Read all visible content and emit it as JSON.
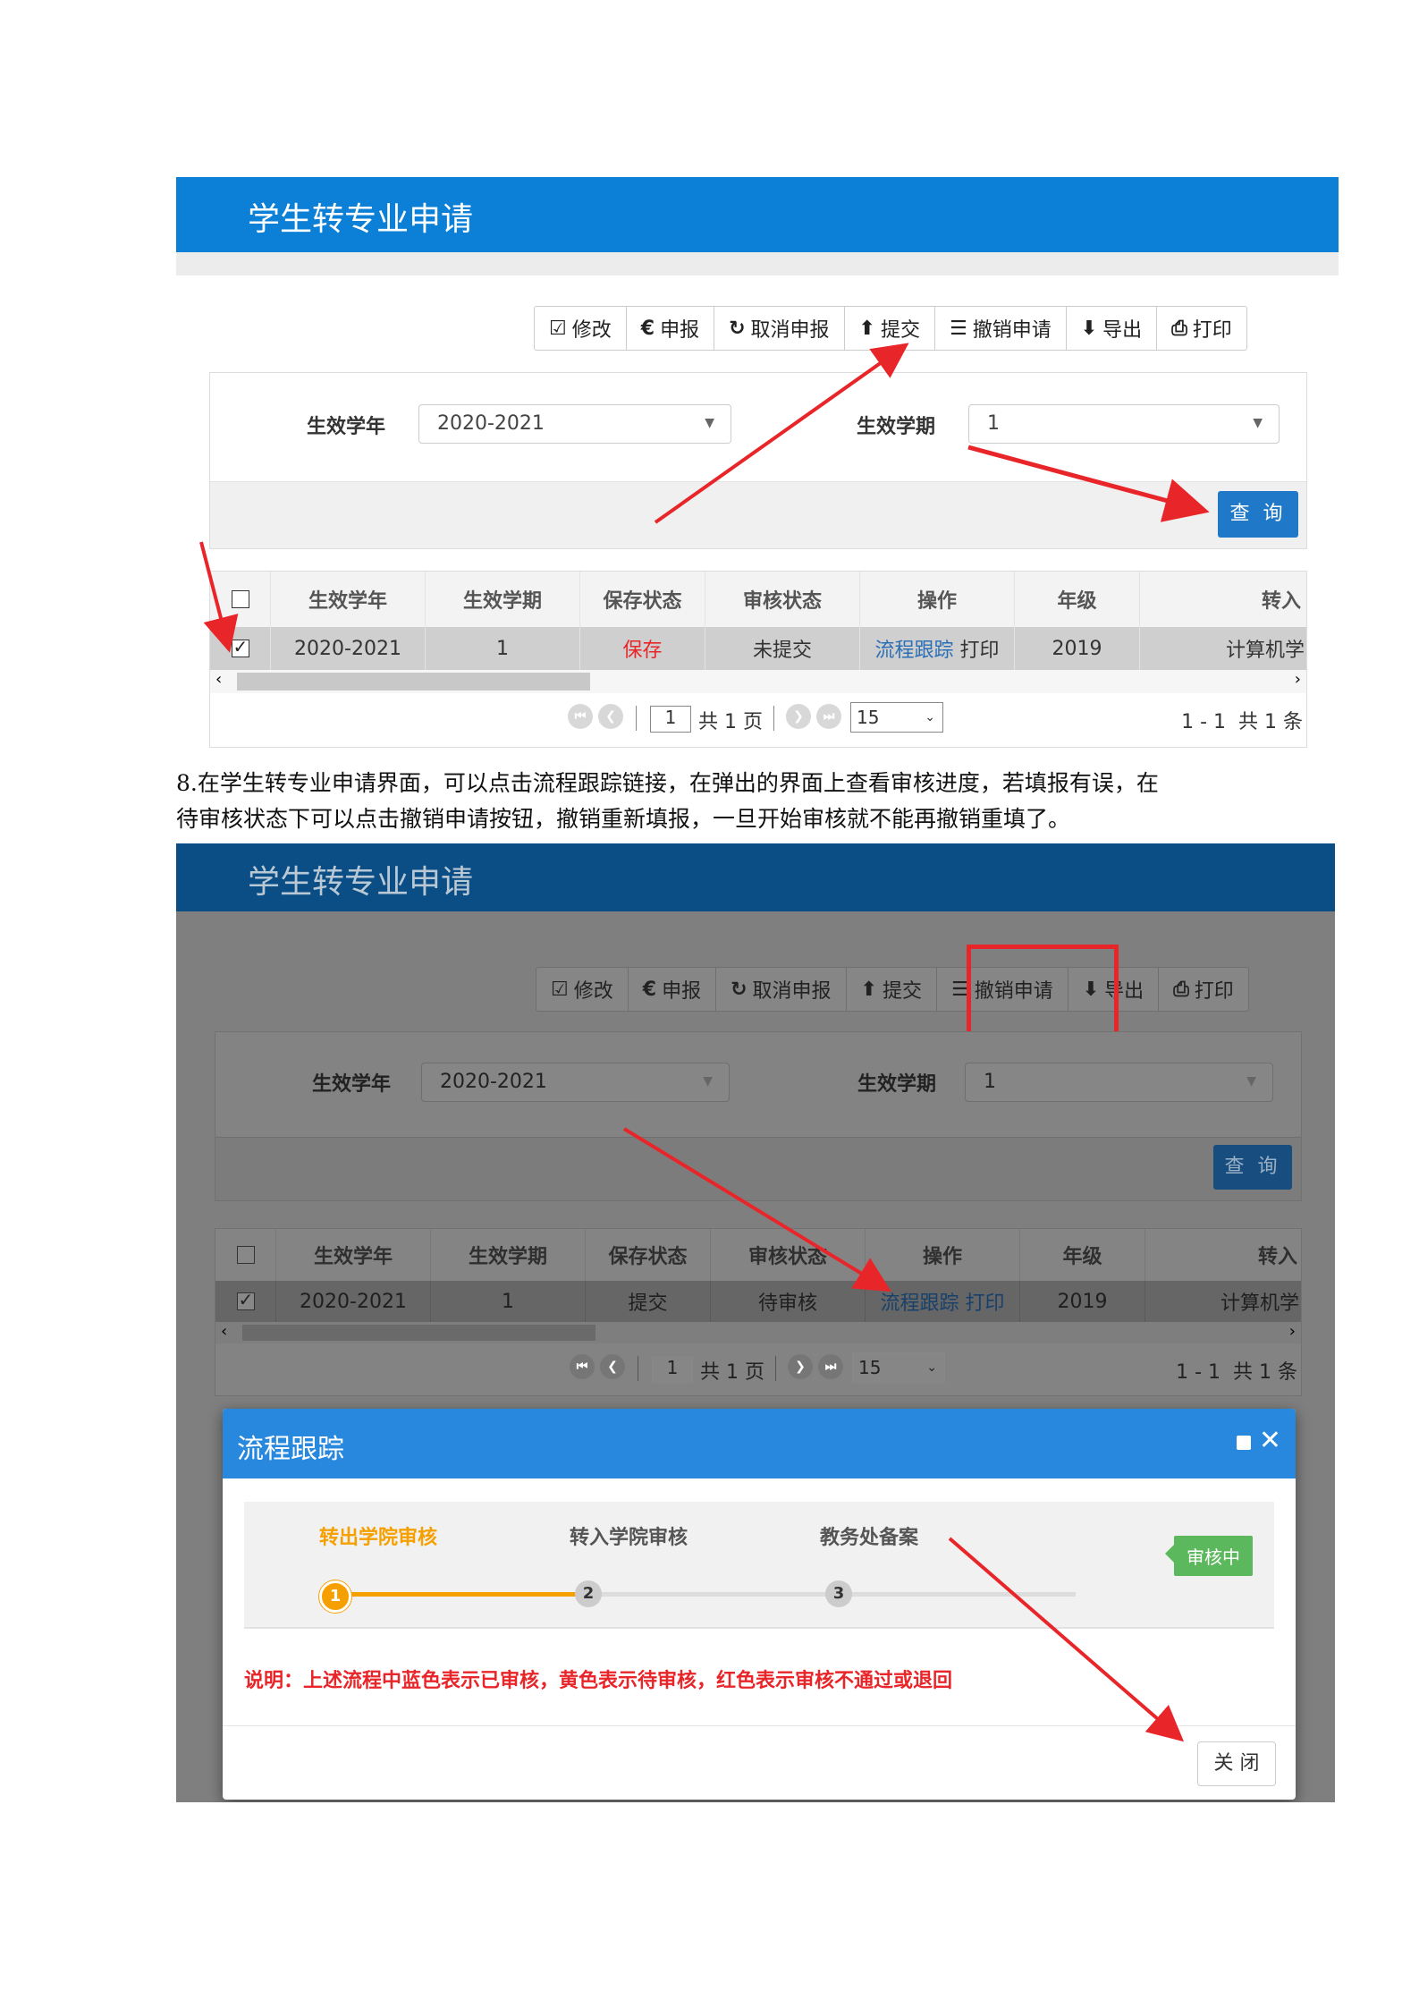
{
  "app_title": "学生转专业申请",
  "toolbar": {
    "edit": "修改",
    "declare": "申报",
    "cancel_declare": "取消申报",
    "submit": "提交",
    "revoke": "撤销申请",
    "export": "导出",
    "print": "打印"
  },
  "filter": {
    "year_label": "生效学年",
    "year_value": "2020-2021",
    "term_label": "生效学期",
    "term_value": "1",
    "query_button": "查 询"
  },
  "grid": {
    "columns": [
      "生效学年",
      "生效学期",
      "保存状态",
      "审核状态",
      "操作",
      "年级",
      "转入"
    ],
    "row1": {
      "year": "2020-2021",
      "term": "1",
      "save_status": "保存",
      "audit_status": "未提交",
      "op_track": "流程跟踪",
      "op_print": "打印",
      "grade": "2019",
      "target": "计算机学"
    },
    "row2": {
      "year": "2020-2021",
      "term": "1",
      "save_status": "提交",
      "audit_status": "待审核",
      "op_track": "流程跟踪",
      "op_print": "打印",
      "grade": "2019",
      "target": "计算机学"
    }
  },
  "pager": {
    "page_value": "1",
    "total_pages": "共 1 页",
    "page_size": "15",
    "summary": "1 - 1  共 1 条"
  },
  "paragraph": {
    "line1": "8.在学生转专业申请界面，可以点击流程跟踪链接，在弹出的界面上查看审核进度，若填报有误，在",
    "line2": "待审核状态下可以点击撤销申请按钮，撤销重新填报，一旦开始审核就不能再撤销重填了。"
  },
  "dialog": {
    "title": "流程跟踪",
    "steps": [
      {
        "label": "转出学院审核",
        "num": "1"
      },
      {
        "label": "转入学院审核",
        "num": "2"
      },
      {
        "label": "教务处备案",
        "num": "3"
      }
    ],
    "badge": "审核中",
    "note": "说明：上述流程中蓝色表示已审核，黄色表示待审核，红色表示审核不通过或退回",
    "close_button": "关 闭"
  },
  "colors": {
    "header_blue": "#0c7fd6",
    "accent_red": "#e8262a",
    "step_orange": "#f5a000",
    "badge_green": "#5cb85c"
  },
  "icons": [
    "edit-icon",
    "euro-icon",
    "refresh-icon",
    "upload-icon",
    "list-icon",
    "export-icon",
    "print-icon",
    "first-page-icon",
    "prev-page-icon",
    "next-page-icon",
    "last-page-icon",
    "maximize-icon",
    "close-icon"
  ]
}
